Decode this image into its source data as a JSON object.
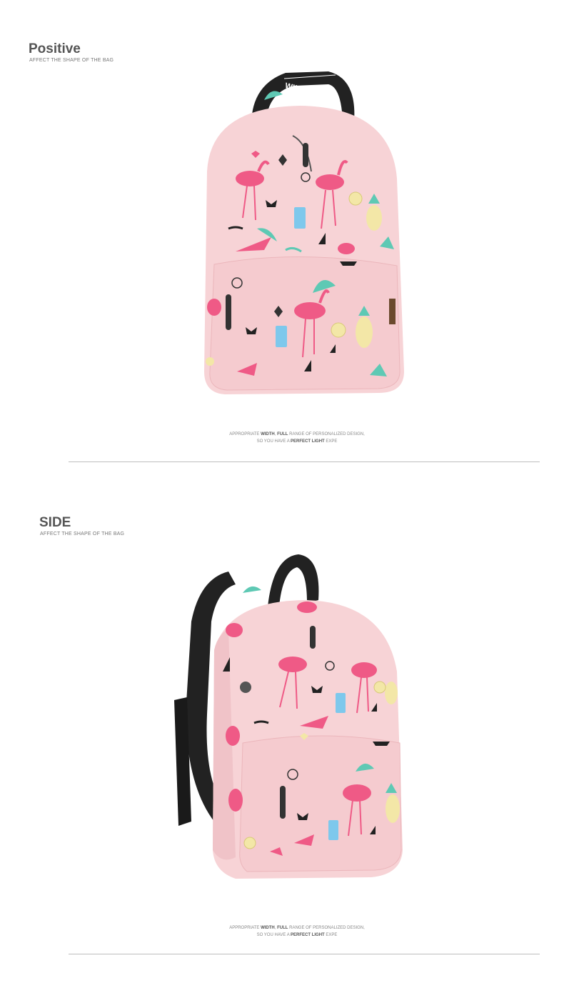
{
  "sections": [
    {
      "title": "Positive",
      "subtitle": "AFFECT THE SHAPE OF THE BAG",
      "caption": {
        "line1": [
          "APPROPRIATE ",
          "WIDTH",
          ", ",
          "FULL",
          " RANGE OF PERSONALIZED DESIGN,"
        ],
        "line2": [
          "SO YOU HAVE A ",
          "PERFECT LIGHT",
          " EXPE"
        ]
      }
    },
    {
      "title": "SIDE",
      "subtitle": "AFFECT THE SHAPE OF THE BAG",
      "caption": {
        "line1": [
          "APPROPRIATE ",
          "WIDTH",
          ", ",
          "FULL",
          " RANGE OF PERSONALIZED DESIGN,"
        ],
        "line2": [
          "SO YOU HAVE A ",
          "PERFECT LIGHT",
          " EXPE"
        ]
      }
    }
  ],
  "strap_text": "WINTER&BAG",
  "colors": {
    "bag_pink": "#f7d3d6",
    "flamingo": "#ef5a86",
    "strap": "#222222",
    "mint": "#5ec9b4",
    "blue": "#7ec8ec",
    "yellow": "#f3e7a7"
  }
}
